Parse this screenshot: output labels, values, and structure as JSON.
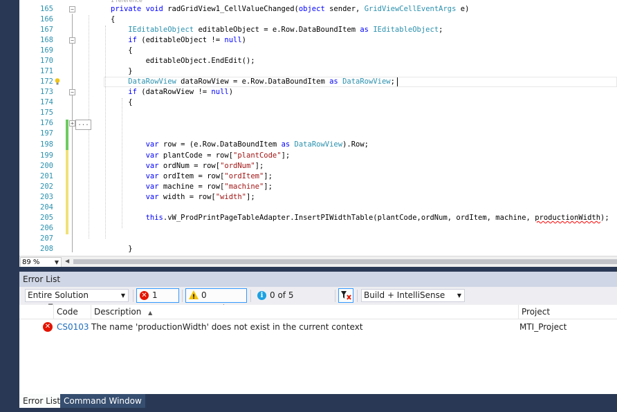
{
  "editor": {
    "reference_hint": "1 reference",
    "lines": [
      {
        "num": "165",
        "code": [
          [
            "kw",
            "private "
          ],
          [
            "kw",
            "void "
          ],
          [
            "",
            "radGridView1_CellValueChanged("
          ],
          [
            "kw",
            "object "
          ],
          [
            "",
            "sender, "
          ],
          [
            "ty",
            "GridViewCellEventArgs "
          ],
          [
            "",
            "e)"
          ]
        ]
      },
      {
        "num": "166",
        "code": [
          [
            "",
            "{"
          ]
        ]
      },
      {
        "num": "167",
        "code": [
          [
            "",
            "    "
          ],
          [
            "ty",
            "IEditableObject "
          ],
          [
            "",
            "editableObject = e.Row.DataBoundItem "
          ],
          [
            "kw",
            "as "
          ],
          [
            "ty",
            "IEditableObject"
          ],
          [
            "",
            ";"
          ]
        ]
      },
      {
        "num": "168",
        "code": [
          [
            "",
            "    "
          ],
          [
            "kw",
            "if "
          ],
          [
            "",
            "(editableObject != "
          ],
          [
            "kw",
            "null"
          ],
          [
            "",
            ")"
          ]
        ]
      },
      {
        "num": "169",
        "code": [
          [
            "",
            "    {"
          ]
        ]
      },
      {
        "num": "170",
        "code": [
          [
            "",
            "        editableObject.EndEdit();"
          ]
        ]
      },
      {
        "num": "171",
        "code": [
          [
            "",
            "    }"
          ]
        ]
      },
      {
        "num": "172",
        "code": [
          [
            "",
            "    "
          ],
          [
            "ty",
            "DataRowView "
          ],
          [
            "",
            "dataRowView = e.Row.DataBoundItem "
          ],
          [
            "kw",
            "as "
          ],
          [
            "ty",
            "DataRowView"
          ],
          [
            "",
            ";"
          ]
        ]
      },
      {
        "num": "173",
        "code": [
          [
            "",
            "    "
          ],
          [
            "kw",
            "if "
          ],
          [
            "",
            "(dataRowView != "
          ],
          [
            "kw",
            "null"
          ],
          [
            "",
            ")"
          ]
        ]
      },
      {
        "num": "174",
        "code": [
          [
            "",
            "    {"
          ]
        ]
      },
      {
        "num": "175",
        "code": []
      },
      {
        "num": "176",
        "code": []
      },
      {
        "num": "197",
        "code": []
      },
      {
        "num": "198",
        "code": [
          [
            "",
            "        "
          ],
          [
            "kw",
            "var "
          ],
          [
            "",
            "row = (e.Row.DataBoundItem "
          ],
          [
            "kw",
            "as "
          ],
          [
            "ty",
            "DataRowView"
          ],
          [
            "",
            ").Row;"
          ]
        ]
      },
      {
        "num": "199",
        "code": [
          [
            "",
            "        "
          ],
          [
            "kw",
            "var "
          ],
          [
            "",
            "plantCode = row["
          ],
          [
            "st",
            "\"plantCode\""
          ],
          [
            "",
            "];"
          ]
        ]
      },
      {
        "num": "200",
        "code": [
          [
            "",
            "        "
          ],
          [
            "kw",
            "var "
          ],
          [
            "",
            "ordNum = row["
          ],
          [
            "st",
            "\"ordNum\""
          ],
          [
            "",
            "];"
          ]
        ]
      },
      {
        "num": "201",
        "code": [
          [
            "",
            "        "
          ],
          [
            "kw",
            "var "
          ],
          [
            "",
            "ordItem = row["
          ],
          [
            "st",
            "\"ordItem\""
          ],
          [
            "",
            "];"
          ]
        ]
      },
      {
        "num": "202",
        "code": [
          [
            "",
            "        "
          ],
          [
            "kw",
            "var "
          ],
          [
            "",
            "machine = row["
          ],
          [
            "st",
            "\"machine\""
          ],
          [
            "",
            "];"
          ]
        ]
      },
      {
        "num": "203",
        "code": [
          [
            "",
            "        "
          ],
          [
            "kw",
            "var "
          ],
          [
            "",
            "width = row["
          ],
          [
            "st",
            "\"width\""
          ],
          [
            "",
            "];"
          ]
        ]
      },
      {
        "num": "204",
        "code": []
      },
      {
        "num": "205",
        "code": [
          [
            "",
            "        "
          ],
          [
            "kw",
            "this"
          ],
          [
            "",
            ".vW_ProdPrintPageTableAdapter.InsertPIWidthTable(plantCode,ordNum, ordItem, machine, "
          ],
          [
            "err",
            "productionWidth"
          ],
          [
            "",
            ");"
          ]
        ]
      },
      {
        "num": "206",
        "code": []
      },
      {
        "num": "207",
        "code": []
      },
      {
        "num": "208",
        "code": [
          [
            "",
            "    }"
          ]
        ]
      }
    ],
    "collapsed_label": "...",
    "zoom": "89 %"
  },
  "error_list": {
    "title": "Error List",
    "scope_combo": "Entire Solution",
    "errors_btn": "1 Error",
    "warnings_btn": "0 Warnings",
    "messages_btn": "0 of 5 Messages",
    "build_combo": "Build + IntelliSense",
    "columns": {
      "code": "Code",
      "description": "Description",
      "project": "Project"
    },
    "rows": [
      {
        "code": "CS0103",
        "description": "The name 'productionWidth' does not exist in the current context",
        "project": "MTI_Project"
      }
    ]
  },
  "tabs": {
    "error_list": "Error List",
    "command_window": "Command Window"
  }
}
